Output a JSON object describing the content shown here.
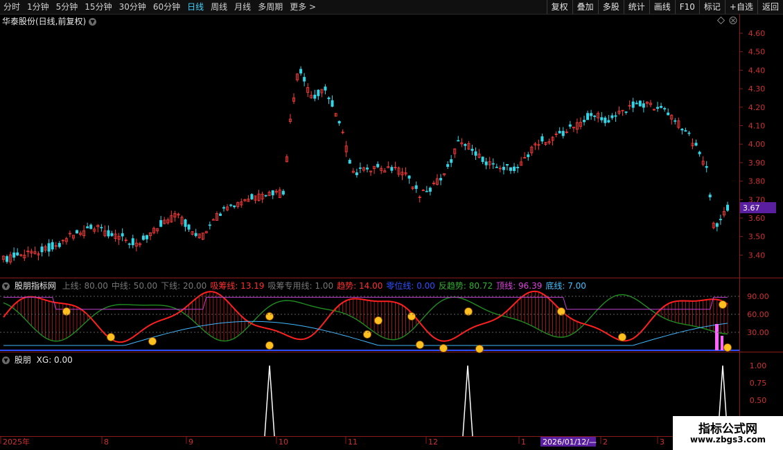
{
  "toolbar": {
    "periods": [
      "分时",
      "1分钟",
      "5分钟",
      "15分钟",
      "30分钟",
      "60分钟",
      "日线",
      "周线",
      "月线",
      "多周期",
      "更多 >"
    ],
    "active_period": "日线",
    "actions": [
      "复权",
      "叠加",
      "多股",
      "统计",
      "画线",
      "F10",
      "标记",
      "+自选",
      "返回"
    ]
  },
  "main_panel": {
    "title": "华泰股份(日线,前复权)",
    "current_price": "3.67",
    "price_ticks": [
      "4.60",
      "4.50",
      "4.40",
      "4.30",
      "4.20",
      "4.10",
      "4.00",
      "3.90",
      "3.80",
      "3.70",
      "3.60",
      "3.50",
      "3.40"
    ]
  },
  "indicator_panel": {
    "name": "股朋指标网",
    "params": [
      {
        "label": "上线: 80.00",
        "color": "#777777"
      },
      {
        "label": "中线: 50.00",
        "color": "#777777"
      },
      {
        "label": "下线: 20.00",
        "color": "#777777"
      },
      {
        "label": "吸筹线: 13.19",
        "color": "#ff3030"
      },
      {
        "label": "吸筹专用线: 1.00",
        "color": "#777777"
      },
      {
        "label": "趋势: 14.00",
        "color": "#ff3030"
      },
      {
        "label": "零位线: 0.00",
        "color": "#3050ff"
      },
      {
        "label": "反趋势: 80.72",
        "color": "#30b030"
      },
      {
        "label": "顶线: 96.39",
        "color": "#e040e0"
      },
      {
        "label": "底线: 7.00",
        "color": "#40c0ff"
      }
    ],
    "ticks": [
      "90.00",
      "60.00",
      "30.00"
    ]
  },
  "signal_panel": {
    "name": "股朋",
    "value_label": "XG: 0.00",
    "ticks": [
      "1.00",
      "0.75",
      "0.50"
    ]
  },
  "time_axis": {
    "labels": [
      "2025年",
      "8",
      "9",
      "10",
      "11",
      "12",
      "1",
      "2",
      "3"
    ],
    "cursor_date": "2026/01/12/—"
  },
  "watermark": {
    "line1": "指标公式网",
    "line2": "www.zbgs3.com"
  },
  "colors": {
    "up": "#ff3b3b",
    "down": "#33d6e6",
    "accent": "#3fd2ff",
    "cursor_bg": "#5a1ea0"
  }
}
